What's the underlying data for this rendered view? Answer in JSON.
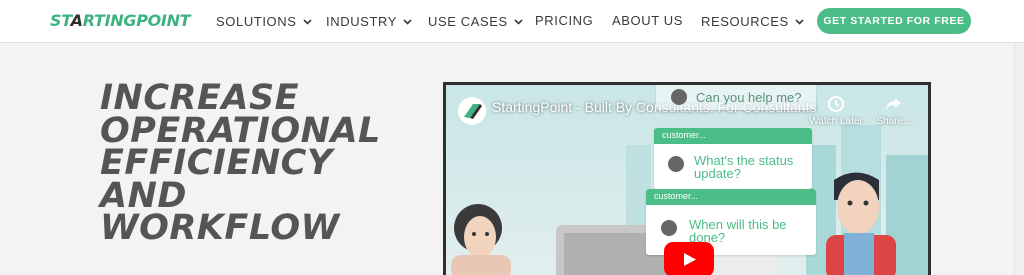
{
  "brand": {
    "logo_part1": "ST",
    "logo_part2": "A",
    "logo_part3": "RTINGPOINT"
  },
  "nav": [
    {
      "label": "SOLUTIONS",
      "dropdown": true
    },
    {
      "label": "INDUSTRY",
      "dropdown": true
    },
    {
      "label": "USE CASES",
      "dropdown": true
    },
    {
      "label": "PRICING",
      "dropdown": false
    },
    {
      "label": "ABOUT US",
      "dropdown": false
    },
    {
      "label": "RESOURCES",
      "dropdown": true
    }
  ],
  "cta": {
    "label": "GET STARTED FOR FREE"
  },
  "hero": {
    "lines": [
      "INCREASE",
      "OPERATIONAL",
      "EFFICIENCY",
      "AND",
      "WORKFLOW"
    ]
  },
  "video": {
    "title": "StartingPoint - Built By Consultants. For Consultants",
    "watch_later": "Watch Later",
    "share": "Share...",
    "bubbles": [
      {
        "header": "",
        "text": "Can you help me?"
      },
      {
        "header": "customer...",
        "text": "What's the status update?"
      },
      {
        "header": "customer...",
        "text": "When will this be done?"
      }
    ]
  },
  "colors": {
    "brand_green": "#4bbd86",
    "heading_gray": "#555555",
    "youtube_red": "#ff0000"
  }
}
